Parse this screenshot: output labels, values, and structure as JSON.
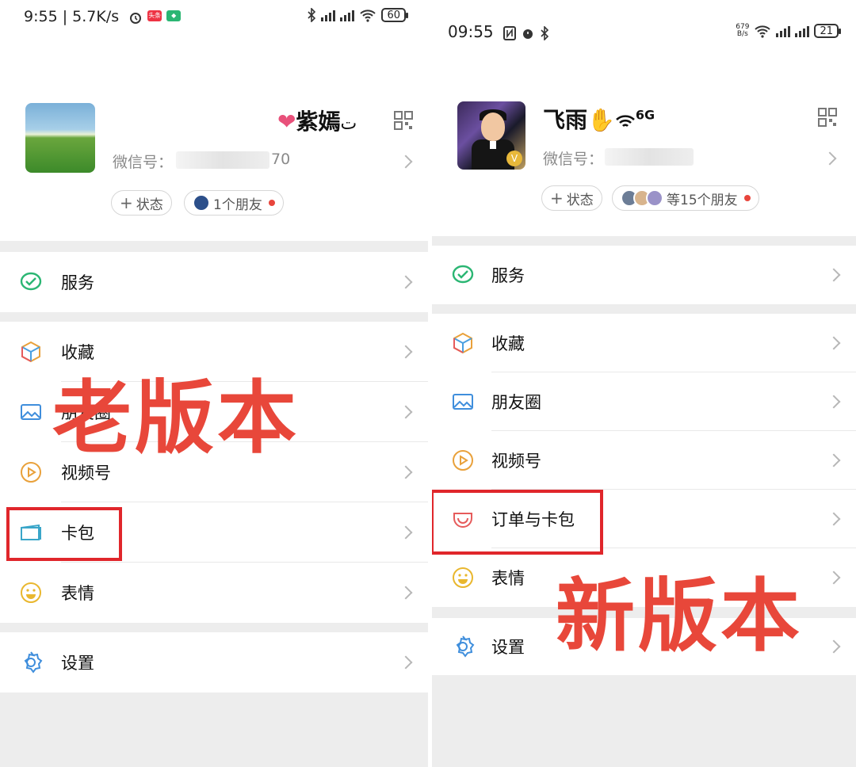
{
  "left": {
    "status": {
      "time": "9:55",
      "speed": "5.7K/s",
      "battery": "60"
    },
    "profile": {
      "nickname": "紫嫣",
      "nickname_suffix": "ت",
      "wxid_label": "微信号：",
      "wxid_tail": "70"
    },
    "chips": {
      "status": "状态",
      "friends": "1个朋友"
    },
    "menu": [
      {
        "label": "服务",
        "icon": "service-icon"
      },
      {
        "label": "收藏",
        "icon": "favorites-icon"
      },
      {
        "label": "朋友圈",
        "icon": "moments-icon"
      },
      {
        "label": "视频号",
        "icon": "channels-icon"
      },
      {
        "label": "卡包",
        "icon": "card-wallet-icon"
      },
      {
        "label": "表情",
        "icon": "emoji-icon"
      },
      {
        "label": "设置",
        "icon": "settings-icon"
      }
    ],
    "overlay": "老版本"
  },
  "right": {
    "status": {
      "time": "09:55",
      "speed_top": "679",
      "speed_bottom": "B/s",
      "battery": "21"
    },
    "profile": {
      "nickname": "飞雨",
      "nickname_suffix": "6G",
      "wxid_label": "微信号：",
      "badge": "V"
    },
    "chips": {
      "status": "状态",
      "friends": "等15个朋友"
    },
    "menu": [
      {
        "label": "服务",
        "icon": "service-icon"
      },
      {
        "label": "收藏",
        "icon": "favorites-icon"
      },
      {
        "label": "朋友圈",
        "icon": "moments-icon"
      },
      {
        "label": "视频号",
        "icon": "channels-icon"
      },
      {
        "label": "订单与卡包",
        "icon": "orders-wallet-icon"
      },
      {
        "label": "表情",
        "icon": "emoji-icon"
      },
      {
        "label": "设置",
        "icon": "settings-icon"
      }
    ],
    "overlay": "新版本"
  },
  "colors": {
    "accent_red": "#e8473a",
    "wechat_green": "#2bb673"
  }
}
